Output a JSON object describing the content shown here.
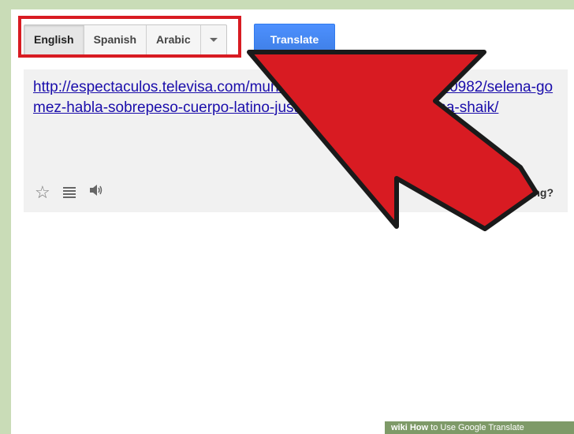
{
  "languages": [
    "English",
    "Spanish",
    "Arabic"
  ],
  "translate_label": "Translate",
  "result_url": "http://espectaculos.televisa.com/mundo/famosos/2013-10-14/30982/selena-gomez-habla-sobrepeso-cuerpo-latino-justin-bieber-novia-shanina-shaik/",
  "wrong_label": "Wrong?",
  "watermark": {
    "brand": "wiki",
    "how": "How",
    "text": "to Use Google Translate"
  },
  "colors": {
    "highlight": "#d81b22",
    "arrow": "#d81b22",
    "button": "#4d90fe",
    "link": "#1a0dab"
  },
  "icons": [
    "star-icon",
    "list-icon",
    "speaker-icon",
    "pencil-icon"
  ]
}
